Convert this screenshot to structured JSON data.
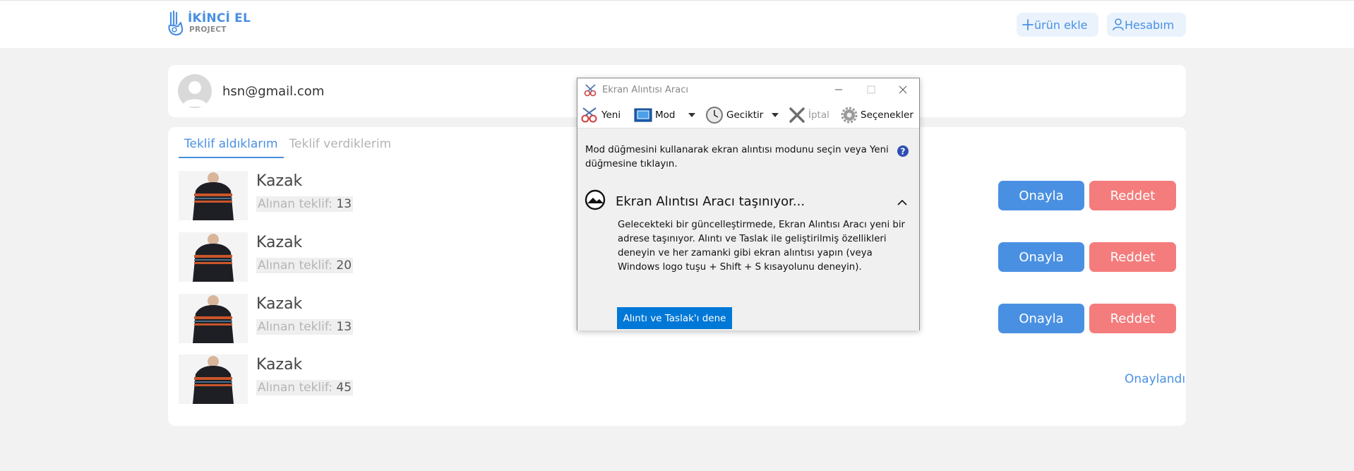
{
  "header": {
    "logo": {
      "title": "İKİNCİ EL",
      "subtitle": "PROJECT",
      "icon": "hand-icon"
    },
    "add_product_label": "ürün ekle",
    "account_label": "Hesabım",
    "accent": "#4a90e2"
  },
  "profile": {
    "email": "hsn@gmail.com"
  },
  "offers": {
    "tabs": [
      {
        "label": "Teklif aldıklarım",
        "active": true
      },
      {
        "label": "Teklif verdiklerim",
        "active": false
      }
    ],
    "items": [
      {
        "name": "Kazak",
        "offer_label": "Alınan teklif:",
        "offer_value": "13",
        "approve_label": "Onayla",
        "reject_label": "Reddet",
        "status": ""
      },
      {
        "name": "Kazak",
        "offer_label": "Alınan teklif:",
        "offer_value": "20",
        "approve_label": "Onayla",
        "reject_label": "Reddet",
        "status": ""
      },
      {
        "name": "Kazak",
        "offer_label": "Alınan teklif:",
        "offer_value": "13",
        "approve_label": "Onayla",
        "reject_label": "Reddet",
        "status": ""
      },
      {
        "name": "Kazak",
        "offer_label": "Alınan teklif:",
        "offer_value": "45",
        "status": "Onaylandı"
      }
    ],
    "colors": {
      "approve": "#4a90e2",
      "reject": "#f47c7c"
    }
  },
  "snipping_tool": {
    "title": "Ekran Alıntısı Aracı",
    "toolbar": {
      "new": "Yeni",
      "mode": "Mod",
      "delay": "Geciktir",
      "cancel": "İptal",
      "options": "Seçenekler"
    },
    "info": "Mod düğmesini kullanarak ekran alıntısı modunu seçin veya Yeni düğmesine tıklayın.",
    "panel": {
      "title": "Ekran Alıntısı Aracı taşınıyor...",
      "body": "Gelecekteki bir güncelleştirmede, Ekran Alıntısı Aracı yeni bir adrese taşınıyor. Alıntı ve Taslak ile geliştirilmiş özellikleri deneyin ve her zamanki gibi ekran alıntısı yapın (veya Windows logo tuşu + Shift + S kısayolunu deneyin).",
      "button": "Alıntı ve Taslak'ı dene"
    }
  }
}
